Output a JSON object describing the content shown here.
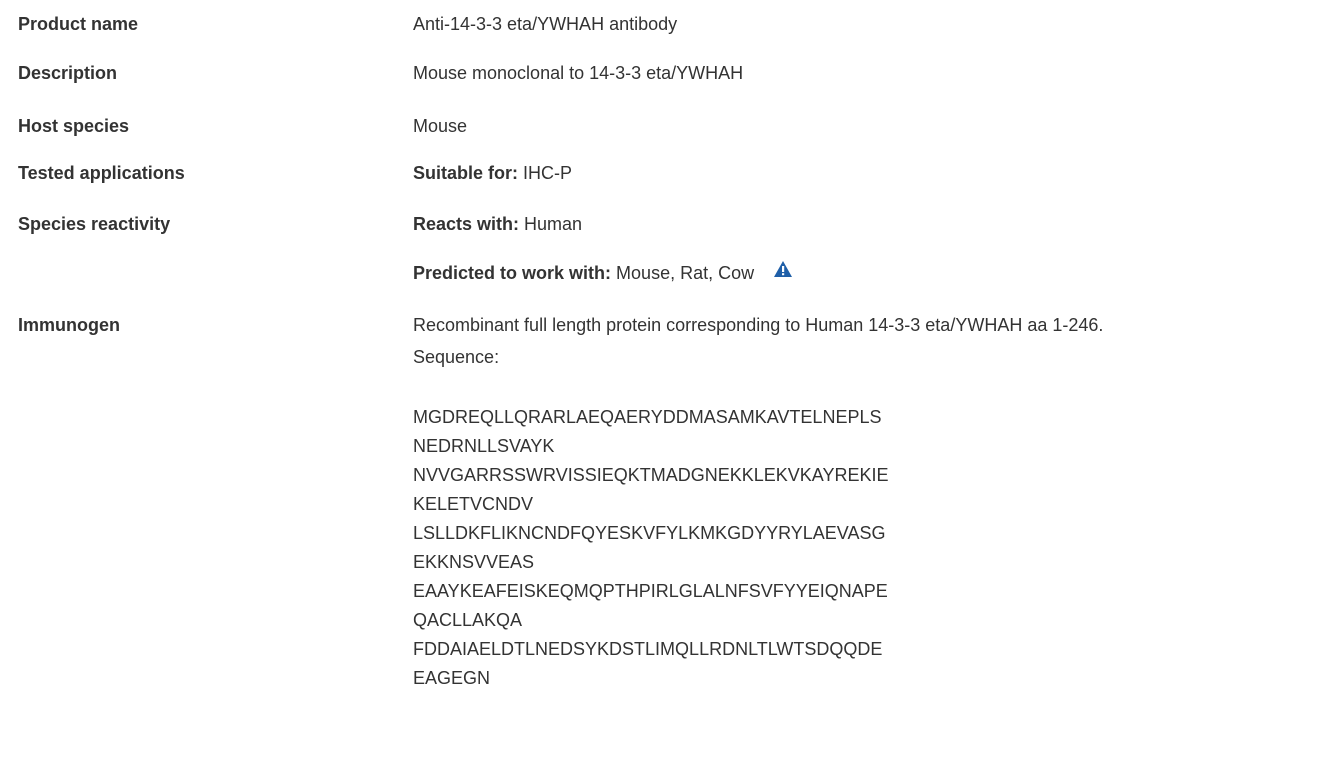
{
  "rows": {
    "product_name": {
      "label": "Product name",
      "value": "Anti-14-3-3 eta/YWHAH antibody"
    },
    "description": {
      "label": "Description",
      "value": "Mouse monoclonal to 14-3-3 eta/YWHAH"
    },
    "host_species": {
      "label": "Host species",
      "value": "Mouse"
    },
    "tested_applications": {
      "label": "Tested applications",
      "prefix": "Suitable for:",
      "value": "IHC-P"
    },
    "species_reactivity": {
      "label": "Species reactivity",
      "reacts_prefix": "Reacts with:",
      "reacts_value": "Human",
      "predicted_prefix": "Predicted to work with:",
      "predicted_value": "Mouse, Rat, Cow",
      "warning_icon": "warning-triangle-icon",
      "warning_color": "#1f5fa8"
    },
    "immunogen": {
      "label": "Immunogen",
      "value_line1": "Recombinant full length protein corresponding to Human 14-3-3 eta/YWHAH aa 1-246.",
      "value_line2": "Sequence:",
      "sequence": [
        "MGDREQLLQRARLAEQAERYDDMASAMKAVTELNEPLS",
        "NEDRNLLSVAYK",
        "NVVGARRSSWRVISSIEQKTMADGNEKKLEKVKAYREKIE",
        "KELETVCNDV",
        "LSLLDKFLIKNCNDFQYESKVFYLKMKGDYYRYLAEVASG",
        "EKKNSVVEAS",
        "EAAYKEAFEISKEQMQPTHPIRLGLALNFSVFYYEIQNAPE",
        "QACLLAKQA",
        "FDDAIAELDTLNEDSYKDSTLIMQLLRDNLTLWTSDQQDE",
        "EAGEGN"
      ]
    }
  }
}
